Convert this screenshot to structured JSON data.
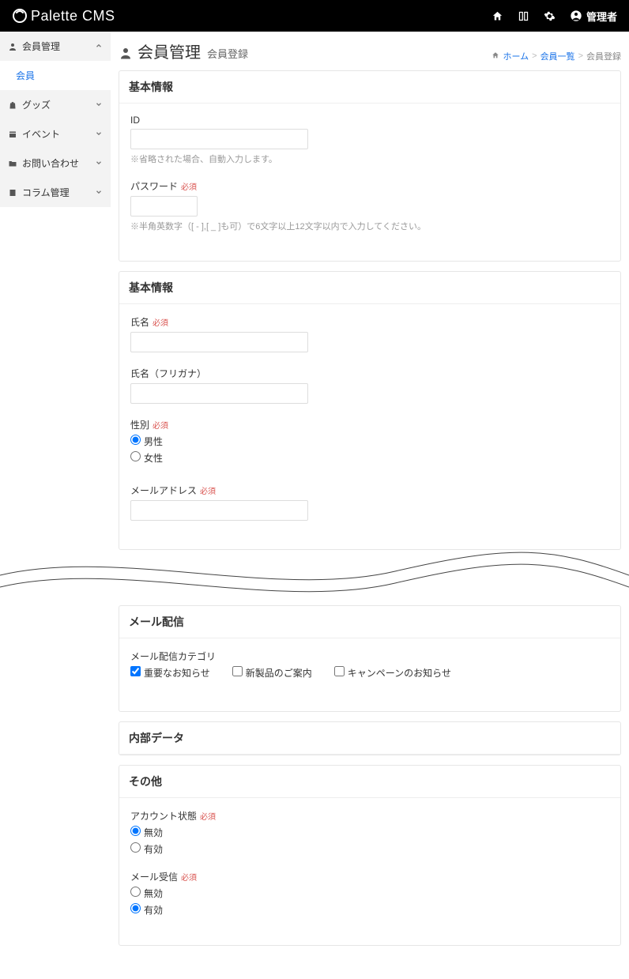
{
  "brand": "Palette CMS",
  "top": {
    "admin": "管理者"
  },
  "sidebar": {
    "items": [
      {
        "label": "会員管理",
        "expanded": true,
        "sub": [
          {
            "label": "会員"
          }
        ]
      },
      {
        "label": "グッズ",
        "expanded": false
      },
      {
        "label": "イベント",
        "expanded": false
      },
      {
        "label": "お問い合わせ",
        "expanded": false
      },
      {
        "label": "コラム管理",
        "expanded": false
      }
    ]
  },
  "page": {
    "title": "会員管理",
    "subtitle": "会員登録"
  },
  "breadcrumb": {
    "home": "ホーム",
    "list": "会員一覧",
    "current": "会員登録"
  },
  "sections": {
    "basic1_title": "基本情報",
    "id_label": "ID",
    "id_help": "※省略された場合、自動入力します。",
    "password_label": "パスワード",
    "required": "必須",
    "password_help": "※半角英数字（[ - ],[ _ ]も可）で6文字以上12文字以内で入力してください。",
    "basic2_title": "基本情報",
    "name_label": "氏名",
    "kana_label": "氏名（フリガナ）",
    "gender_label": "性別",
    "gender_male": "男性",
    "gender_female": "女性",
    "email_label": "メールアドレス",
    "mail_title": "メール配信",
    "mail_cat_label": "メール配信カテゴリ",
    "mail_opt1": "重要なお知らせ",
    "mail_opt2": "新製品のご案内",
    "mail_opt3": "キャンペーンのお知らせ",
    "internal_title": "内部データ",
    "other_title": "その他",
    "account_status_label": "アカウント状態",
    "status_disabled": "無効",
    "status_enabled": "有効",
    "mail_recv_label": "メール受信"
  }
}
